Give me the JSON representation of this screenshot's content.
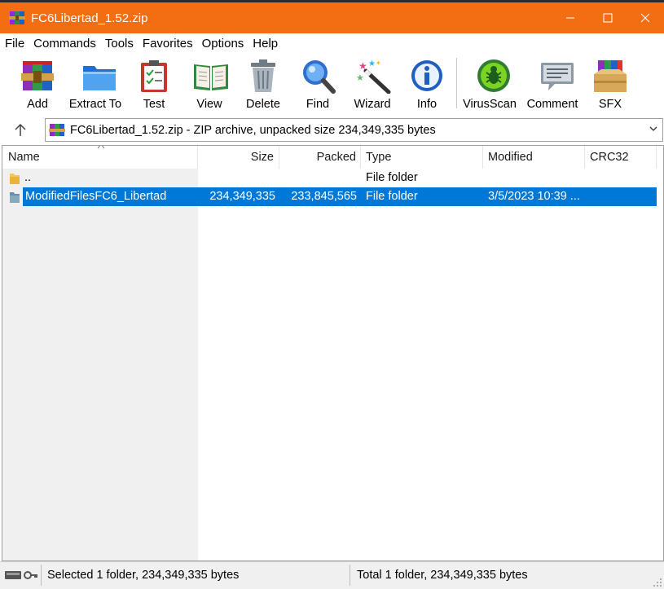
{
  "window": {
    "title": "FC6Libertad_1.52.zip",
    "accent": "#f36d13",
    "controls": [
      "minimize-icon",
      "maximize-icon",
      "close-icon"
    ]
  },
  "menu": [
    "File",
    "Commands",
    "Tools",
    "Favorites",
    "Options",
    "Help"
  ],
  "toolbar": {
    "buttons": [
      {
        "label": "Add",
        "icon": "add-archive-icon"
      },
      {
        "label": "Extract To",
        "icon": "extract-folder-icon"
      },
      {
        "label": "Test",
        "icon": "test-clipboard-icon"
      },
      {
        "label": "View",
        "icon": "view-book-icon"
      },
      {
        "label": "Delete",
        "icon": "trash-can-icon"
      },
      {
        "label": "Find",
        "icon": "magnifier-icon"
      },
      {
        "label": "Wizard",
        "icon": "magic-wand-icon"
      },
      {
        "label": "Info",
        "icon": "info-icon"
      },
      {
        "label": "VirusScan",
        "icon": "virus-scan-icon"
      },
      {
        "label": "Comment",
        "icon": "comment-icon"
      },
      {
        "label": "SFX",
        "icon": "sfx-box-icon"
      }
    ]
  },
  "address": {
    "path": "FC6Libertad_1.52.zip - ZIP archive, unpacked size 234,349,335 bytes"
  },
  "columns": [
    "Name",
    "Size",
    "Packed",
    "Type",
    "Modified",
    "CRC32"
  ],
  "rows": [
    {
      "name": "..",
      "size": "",
      "packed": "",
      "type": "File folder",
      "modified": "",
      "crc": "",
      "selected": false
    },
    {
      "name": "ModifiedFilesFC6_Libertad",
      "size": "234,349,335",
      "packed": "233,845,565",
      "type": "File folder",
      "modified": "3/5/2023 10:39 ...",
      "crc": "",
      "selected": true
    }
  ],
  "status": {
    "left": "Selected 1 folder, 234,349,335 bytes",
    "right": "Total 1 folder, 234,349,335 bytes"
  }
}
